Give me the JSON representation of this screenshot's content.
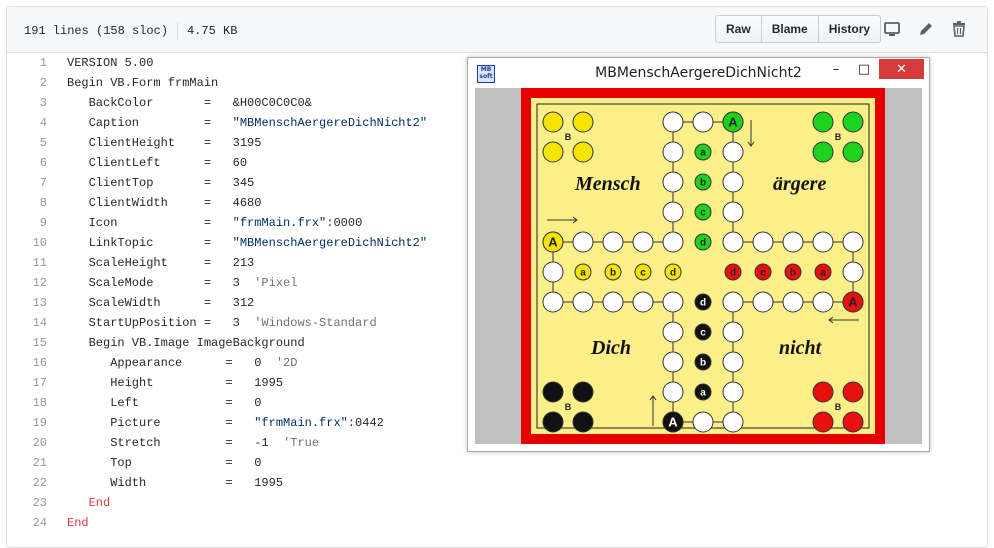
{
  "file_info": {
    "lines": "191 lines (158 sloc)",
    "size": "4.75 KB"
  },
  "actions": {
    "raw": "Raw",
    "blame": "Blame",
    "history": "History"
  },
  "icons": [
    "desktop-icon",
    "pencil-icon",
    "trash-icon"
  ],
  "code": [
    {
      "n": "1",
      "t": "VERSION 5.00"
    },
    {
      "n": "2",
      "t": "Begin VB.Form frmMain"
    },
    {
      "n": "3",
      "t": "   BackColor       =   &H00C0C0C0&"
    },
    {
      "n": "4",
      "t": "   Caption         =   \"MBMenschAergereDichNicht2\""
    },
    {
      "n": "5",
      "t": "   ClientHeight    =   3195"
    },
    {
      "n": "6",
      "t": "   ClientLeft      =   60"
    },
    {
      "n": "7",
      "t": "   ClientTop       =   345"
    },
    {
      "n": "8",
      "t": "   ClientWidth     =   4680"
    },
    {
      "n": "9",
      "t": "   Icon            =   \"frmMain.frx\":0000"
    },
    {
      "n": "10",
      "t": "   LinkTopic       =   \"MBMenschAergereDichNicht2\""
    },
    {
      "n": "11",
      "t": "   ScaleHeight     =   213"
    },
    {
      "n": "12",
      "t": "   ScaleMode       =   3  'Pixel"
    },
    {
      "n": "13",
      "t": "   ScaleWidth      =   312"
    },
    {
      "n": "14",
      "t": "   StartUpPosition =   3  'Windows-Standard"
    },
    {
      "n": "15",
      "t": "   Begin VB.Image ImageBackground"
    },
    {
      "n": "16",
      "t": "      Appearance      =   0  '2D"
    },
    {
      "n": "17",
      "t": "      Height          =   1995"
    },
    {
      "n": "18",
      "t": "      Left            =   0"
    },
    {
      "n": "19",
      "t": "      Picture         =   \"frmMain.frx\":0442"
    },
    {
      "n": "20",
      "t": "      Stretch         =   -1  'True"
    },
    {
      "n": "21",
      "t": "      Top             =   0"
    },
    {
      "n": "22",
      "t": "      Width           =   1995"
    },
    {
      "n": "23",
      "t": "   End"
    },
    {
      "n": "24",
      "t": "End"
    }
  ],
  "window": {
    "title": "MBMenschAergereDichNicht2",
    "icon_text": "MB\nsoft",
    "controls": {
      "minimize": "–",
      "maximize": "□",
      "close": "✕"
    }
  },
  "board": {
    "words": {
      "mensch": "Mensch",
      "aergere": "ärgere",
      "dich": "Dich",
      "nicht": "nicht"
    },
    "home_letters": {
      "yellow": "B",
      "green": "B",
      "black": "B",
      "red": "B"
    },
    "start_letter": "A",
    "goal_letters": [
      "a",
      "b",
      "c",
      "d"
    ],
    "colors": {
      "yellow": "#f5e300",
      "green": "#1ed31e",
      "black": "#111111",
      "red": "#e81010",
      "board": "#fbef8a",
      "frame": "#e60000"
    }
  }
}
